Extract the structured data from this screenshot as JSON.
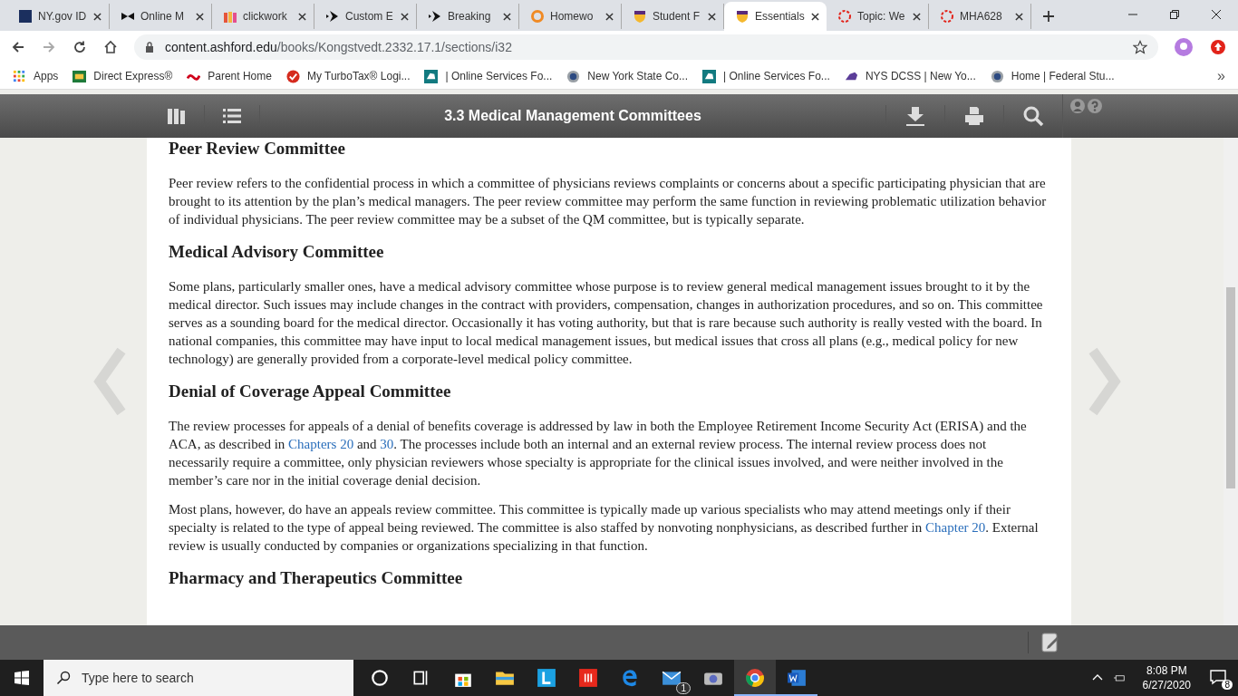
{
  "browser": {
    "tabs": [
      {
        "title": "NY.gov ID",
        "selected": false
      },
      {
        "title": "Online M",
        "selected": false
      },
      {
        "title": "clickwork",
        "selected": false
      },
      {
        "title": "Custom E",
        "selected": false
      },
      {
        "title": "Breaking",
        "selected": false
      },
      {
        "title": "Homewo",
        "selected": false
      },
      {
        "title": "Student F",
        "selected": false
      },
      {
        "title": "Essentials",
        "selected": true
      },
      {
        "title": "Topic: We",
        "selected": false
      },
      {
        "title": "MHA628",
        "selected": false
      }
    ],
    "address_host": "content.ashford.edu",
    "address_path": "/books/Kongstvedt.2332.17.1/sections/i32",
    "bookmarks": [
      {
        "label": "Apps"
      },
      {
        "label": "Direct Express®"
      },
      {
        "label": "Parent Home"
      },
      {
        "label": "My TurboTax® Logi..."
      },
      {
        "label": "| Online Services Fo..."
      },
      {
        "label": "New York State Co..."
      },
      {
        "label": "| Online Services Fo..."
      },
      {
        "label": "NYS DCSS | New Yo..."
      },
      {
        "label": "Home | Federal Stu..."
      }
    ],
    "more_bookmarks": "»"
  },
  "reader": {
    "title": "3.3 Medical Management Committees",
    "sections": [
      {
        "heading": "Peer Review Committee",
        "paragraphs": [
          [
            {
              "text": "Peer review refers to the confidential process in which a committee of physicians reviews complaints or concerns about a specific participating physician that are brought to its attention by the plan’s medical managers. The peer review committee may perform the same function in reviewing problematic utilization behavior of individual physicians. The peer review committee may be a subset of the QM committee, but is typically separate.",
              "kind": "text"
            }
          ]
        ]
      },
      {
        "heading": "Medical Advisory Committee",
        "paragraphs": [
          [
            {
              "text": "Some plans, particularly smaller ones, have a medical advisory committee whose purpose is to review general medical management issues brought to it by the medical director. Such issues may include changes in the contract with providers, compensation, changes in authorization procedures, and so on. This committee serves as a sounding board for the medical director. Occasionally it has voting authority, but that is rare because such authority is really vested with the board. In national companies, this committee may have input to local medical management issues, but medical issues that cross all plans (e.g., medical policy for new technology) are generally provided from a corporate-level medical policy committee.",
              "kind": "text"
            }
          ]
        ]
      },
      {
        "heading": "Denial of Coverage Appeal Committee",
        "paragraphs": [
          [
            {
              "text": "The review processes for appeals of a denial of benefits coverage is addressed by law in both the Employee Retirement Income Security Act (ERISA) and the ACA, as described in ",
              "kind": "text"
            },
            {
              "text": "Chapters 20",
              "kind": "link"
            },
            {
              "text": " and ",
              "kind": "text"
            },
            {
              "text": "30",
              "kind": "link"
            },
            {
              "text": ". The processes include both an internal and an external review process. The internal review process does not necessarily require a committee, only physician reviewers whose specialty is appropriate for the clinical issues involved, and were neither involved in the member’s care nor in the initial coverage denial decision.",
              "kind": "text"
            }
          ],
          [
            {
              "text": "Most plans, however, do have an appeals review committee. This committee is typically made up various specialists who may attend meetings only if their specialty is related to the type of appeal being reviewed. The committee is also staffed by nonvoting nonphysicians, as described further in ",
              "kind": "text"
            },
            {
              "text": "Chapter 20",
              "kind": "link"
            },
            {
              "text": ". External review is usually conducted by companies or organizations specializing in that function.",
              "kind": "text"
            }
          ]
        ]
      },
      {
        "heading": "Pharmacy and Therapeutics Committee"
      }
    ]
  },
  "taskbar": {
    "search_placeholder": "Type here to search",
    "mail_badge": "1",
    "time": "8:08 PM",
    "date": "6/27/2020",
    "notifications": "8"
  }
}
